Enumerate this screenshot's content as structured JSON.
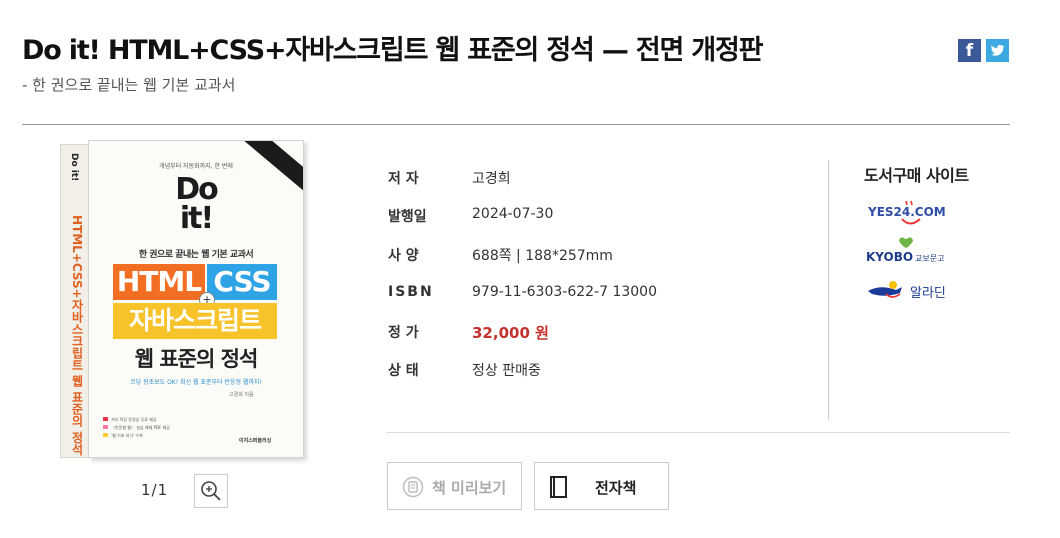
{
  "book": {
    "title": "Do it! HTML+CSS+자바스크립트 웹 표준의 정석 — 전면 개정판",
    "subtitle": "- 한 권으로 끝내는 웹 기본 교과서"
  },
  "social": {
    "facebook": "f",
    "twitter": "t"
  },
  "cover": {
    "small_line": "개념부터 자동화까지, 한 번에",
    "doit_1": "Do",
    "doit_2": "it!",
    "tagline": "한 권으로 끝내는 웹 기본 교과서",
    "html": "HTML",
    "css": "CSS",
    "plus": "+",
    "js": "자바스크립트",
    "web": "웹 표준의 정석",
    "line": "코딩 왕초보도 OK! 최신 웹 표준부터 반응형 웹까지!",
    "author": "고경희 지음",
    "bullets": [
      "저자 직강 동영상 무료 제공",
      "〈반응형 웹〉 실습 예제 PDF 제공",
      "'웹 기초 지식' 수록"
    ],
    "publisher": "이지스퍼블리싱",
    "spine_title": "HTML+CSS+자바스크립트 웹 표준의 정석",
    "spine_top": "Do it!"
  },
  "gallery": {
    "pager": "1/1"
  },
  "info": {
    "author_label": "저 자",
    "author": "고경희",
    "date_label": "발행일",
    "date": "2024-07-30",
    "spec_label": "사 양",
    "spec": "688쪽 | 188*257mm",
    "isbn_label": "ISBN",
    "isbn": "979-11-6303-622-7 13000",
    "price_label": "정 가",
    "price": "32,000 원",
    "status_label": "상 태",
    "status": "정상 판매중"
  },
  "buy": {
    "title": "도서구매 사이트",
    "yes24": "YES24.COM",
    "kyobo": "KYOBO",
    "kyobo_sub": "교보문고",
    "aladin": "알라딘"
  },
  "buttons": {
    "preview": "책 미리보기",
    "ebook": "전자책"
  },
  "colors": {
    "price": "#c4322e",
    "facebook": "#3b5998",
    "twitter": "#3da9e3",
    "html": "#f26e22",
    "css": "#2ea3e5",
    "js": "#f7c22a"
  }
}
